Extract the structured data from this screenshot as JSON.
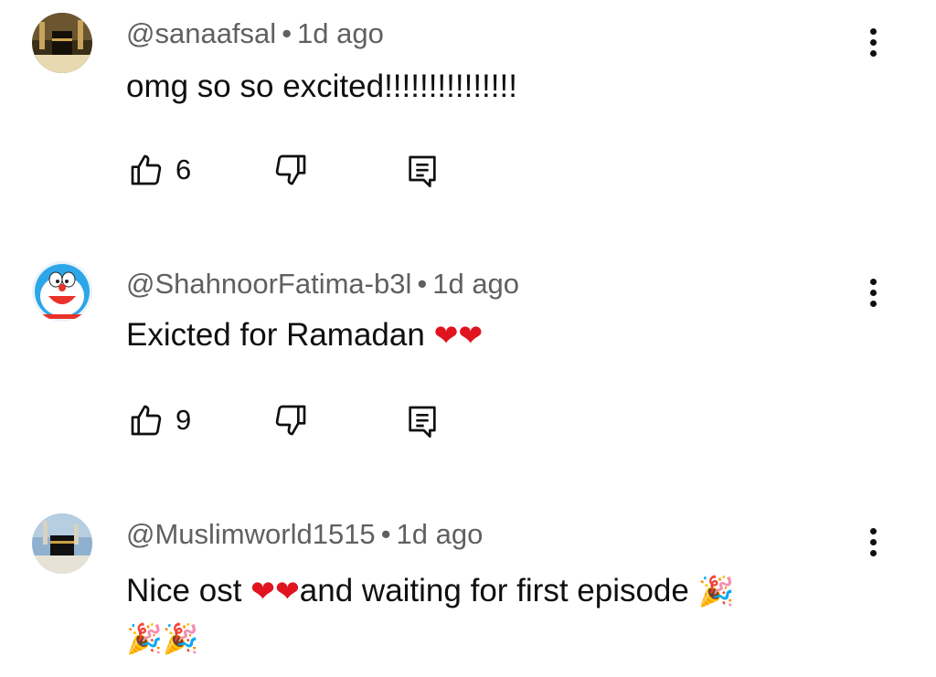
{
  "comments": [
    {
      "handle": "@sanaafsal",
      "time": "1d ago",
      "text": "omg so so excited!!!!!!!!!!!!!!!",
      "likes": "6",
      "avatar_icon": "kaaba-night-avatar"
    },
    {
      "handle": "@ShahnoorFatima-b3l",
      "time": "1d ago",
      "text": "Exicted for Ramadan",
      "emoji": "❤❤",
      "likes": "9",
      "avatar_icon": "doraemon-avatar"
    },
    {
      "handle": "@Muslimworld1515",
      "time": "1d ago",
      "text_before": "Nice ost",
      "emoji_hearts": "❤❤",
      "text_after": "and waiting for first episode",
      "emoji_party": "🎉",
      "emoji_party_line": "🎉🎉",
      "avatar_icon": "kaaba-day-avatar"
    }
  ],
  "separator": "•",
  "colors": {
    "meta_text": "#606060",
    "heart": "#e0131f"
  }
}
